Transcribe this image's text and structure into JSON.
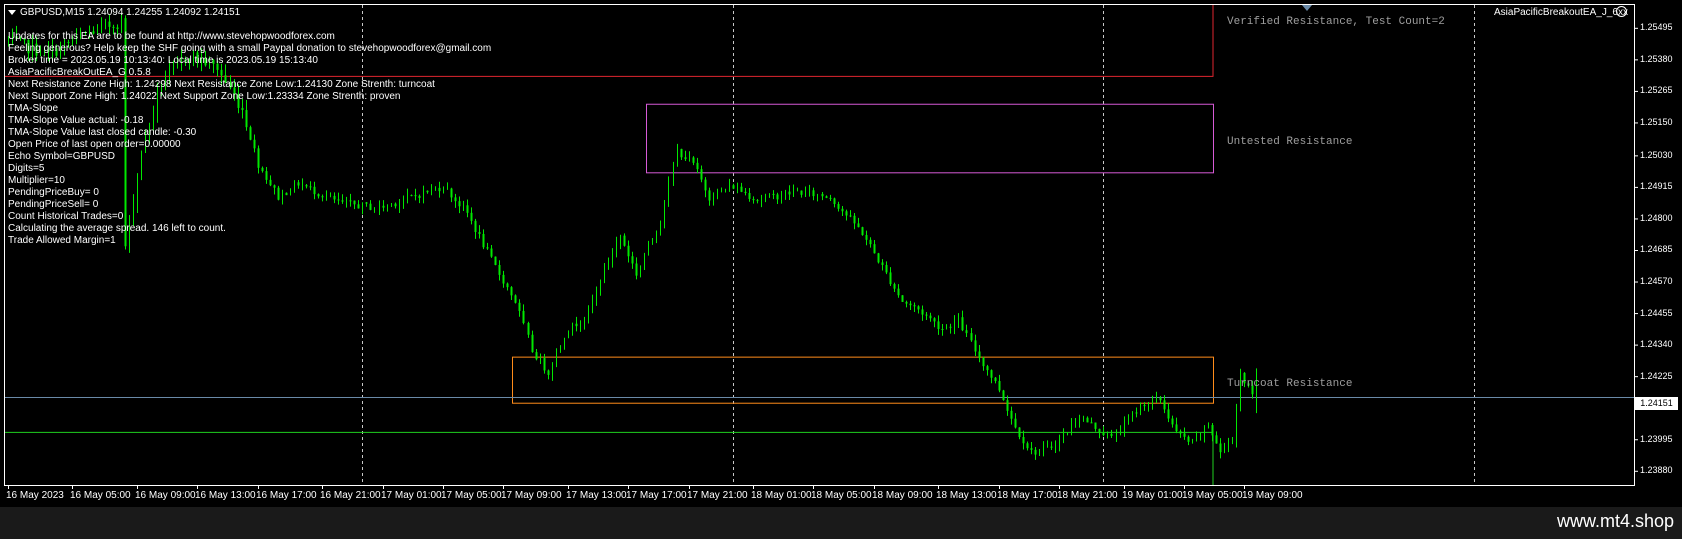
{
  "header": {
    "symbol_line": "GBPUSD,M15  1.24094 1.24255 1.24092 1.24151",
    "ea_label": "AsiaPacificBreakoutEA_J_6xx"
  },
  "info_lines": [
    "Updates for this EA are to be found at http://www.stevehopwoodforex.com",
    "Feeling generous? Help keep the SHF going with a small Paypal donation to stevehopwoodforex@gmail.com",
    "Broker time = 2023.05.19 10:13:40: Local time is 2023.05.19 15:13:40",
    "AsiaPacificBreakOutEA_G 0.5.8",
    "Next Resistance Zone High: 1.24298 Next Resistance Zone Low:1.24130  Zone Strenth: turncoat",
    "Next Support Zone High: 1.24022 Next Support Zone Low:1.23334  Zone Strenth: proven",
    "TMA-Slope",
    "TMA-Slope Value actual: -0.18",
    "TMA-Slope Value last closed candle: -0.30",
    "Open Price of last open order=0.00000",
    "Echo Symbol=GBPUSD",
    "Digits=5",
    "Multiplier=10",
    "PendingPriceBuy= 0",
    "PendingPriceSell= 0",
    "Count Historical Trades=0",
    "Calculating the average spread. 146 left to count.",
    "Trade Allowed Margin=1"
  ],
  "zones": [
    {
      "label": "Verified Resistance, Test Count=2",
      "high": 1.2558,
      "low": 1.2532,
      "color": "#e0262f"
    },
    {
      "label": "Untested Resistance",
      "high": 1.2522,
      "low": 1.2497,
      "color": "#d65ad6"
    },
    {
      "label": "Turncoat Resistance",
      "high": 1.24298,
      "low": 1.2413,
      "color": "#ff8c1a"
    },
    {
      "label": "",
      "high": 1.24022,
      "low": 1.2333,
      "color": "#1fcf1f"
    }
  ],
  "current_price": "1.24151",
  "watermark": "www.mt4.shop",
  "colors": {
    "background": "#000000",
    "candle": "#00e800",
    "current_price_line": "#6a8aa8",
    "grid": "#c8c8c8",
    "frame": "#ffffff"
  },
  "chart_data": {
    "type": "candlestick",
    "symbol": "GBPUSD",
    "timeframe": "M15",
    "ylim": [
      1.2383,
      1.2558
    ],
    "xlim": [
      0,
      403
    ],
    "y_ticks": [
      "1.25495",
      "1.25380",
      "1.25265",
      "1.25150",
      "1.25030",
      "1.24915",
      "1.24800",
      "1.24685",
      "1.24570",
      "1.24455",
      "1.24340",
      "1.24225",
      "1.24110",
      "1.23995",
      "1.23880"
    ],
    "x_ticks": [
      {
        "label": "16 May 2023",
        "i": 0
      },
      {
        "label": "16 May 05:00",
        "i": 16
      },
      {
        "label": "16 May 09:00",
        "i": 32
      },
      {
        "label": "16 May 13:00",
        "i": 47
      },
      {
        "label": "16 May 17:00",
        "i": 62
      },
      {
        "label": "16 May 21:00",
        "i": 78
      },
      {
        "label": "17 May 01:00",
        "i": 93
      },
      {
        "label": "17 May 05:00",
        "i": 108
      },
      {
        "label": "17 May 09:00",
        "i": 123
      },
      {
        "label": "17 May 13:00",
        "i": 139
      },
      {
        "label": "17 May 17:00",
        "i": 154
      },
      {
        "label": "17 May 21:00",
        "i": 169
      },
      {
        "label": "18 May 01:00",
        "i": 185
      },
      {
        "label": "18 May 05:00",
        "i": 200
      },
      {
        "label": "18 May 09:00",
        "i": 215
      },
      {
        "label": "18 May 13:00",
        "i": 231
      },
      {
        "label": "18 May 17:00",
        "i": 246
      },
      {
        "label": "18 May 21:00",
        "i": 261
      },
      {
        "label": "19 May 01:00",
        "i": 277
      },
      {
        "label": "19 May 05:00",
        "i": 292
      },
      {
        "label": "19 May 09:00",
        "i": 307
      }
    ],
    "separators": [
      88,
      180,
      272,
      364
    ],
    "price_line": 1.24151,
    "path": [
      [
        0,
        1.2545
      ],
      [
        10,
        1.254
      ],
      [
        20,
        1.2548
      ],
      [
        28,
        1.2552
      ],
      [
        29,
        1.247
      ],
      [
        33,
        1.2505
      ],
      [
        38,
        1.253
      ],
      [
        45,
        1.254
      ],
      [
        52,
        1.2535
      ],
      [
        58,
        1.252
      ],
      [
        62,
        1.25
      ],
      [
        67,
        1.2488
      ],
      [
        72,
        1.2493
      ],
      [
        82,
        1.2486
      ],
      [
        92,
        1.2484
      ],
      [
        100,
        1.2488
      ],
      [
        108,
        1.2492
      ],
      [
        114,
        1.2482
      ],
      [
        120,
        1.2465
      ],
      [
        126,
        1.245
      ],
      [
        130,
        1.2432
      ],
      [
        134,
        1.2424
      ],
      [
        138,
        1.2438
      ],
      [
        144,
        1.2446
      ],
      [
        148,
        1.2462
      ],
      [
        152,
        1.2474
      ],
      [
        156,
        1.246
      ],
      [
        162,
        1.248
      ],
      [
        166,
        1.2505
      ],
      [
        170,
        1.25
      ],
      [
        174,
        1.2488
      ],
      [
        180,
        1.2492
      ],
      [
        186,
        1.2487
      ],
      [
        196,
        1.249
      ],
      [
        204,
        1.2488
      ],
      [
        212,
        1.2475
      ],
      [
        218,
        1.246
      ],
      [
        222,
        1.245
      ],
      [
        226,
        1.2447
      ],
      [
        232,
        1.244
      ],
      [
        236,
        1.2443
      ],
      [
        240,
        1.2432
      ],
      [
        246,
        1.2418
      ],
      [
        250,
        1.2404
      ],
      [
        254,
        1.2395
      ],
      [
        258,
        1.2396
      ],
      [
        262,
        1.2401
      ],
      [
        266,
        1.2408
      ],
      [
        270,
        1.2404
      ],
      [
        274,
        1.24
      ],
      [
        278,
        1.2407
      ],
      [
        282,
        1.2413
      ],
      [
        286,
        1.2414
      ],
      [
        290,
        1.2402
      ],
      [
        294,
        1.2398
      ],
      [
        298,
        1.2405
      ],
      [
        301,
        1.2395
      ],
      [
        304,
        1.24
      ],
      [
        306,
        1.2424
      ],
      [
        308,
        1.2418
      ],
      [
        310,
        1.24151
      ]
    ],
    "last_bar": {
      "open": 1.24094,
      "high": 1.24255,
      "low": 1.24092,
      "close": 1.24151
    }
  }
}
